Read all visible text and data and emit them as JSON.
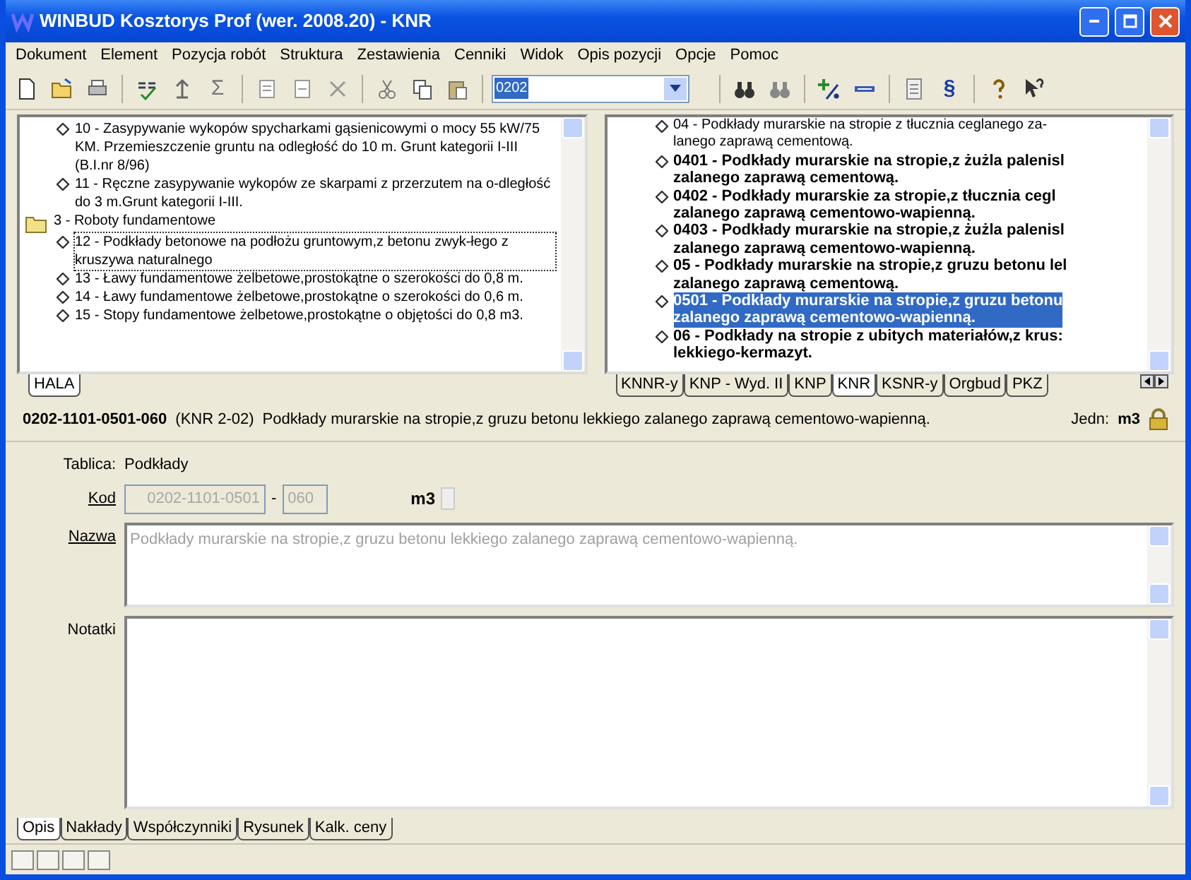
{
  "window": {
    "title": "WINBUD Kosztorys Prof (wer. 2008.20) - KNR"
  },
  "menu": [
    "Dokument",
    "Element",
    "Pozycja robót",
    "Struktura",
    "Zestawienia",
    "Cenniki",
    "Widok",
    "Opis pozycji",
    "Opcje",
    "Pomoc"
  ],
  "toolbar": {
    "sigma_glyph": "Σ",
    "combo_value": "0202",
    "section_glyph": "§"
  },
  "left_tree": {
    "items": [
      {
        "kind": "item",
        "text": "10 - Zasypywanie wykopów spycharkami gąsienicowymi o mocy 55 kW/75 KM. Przemieszczenie gruntu na odległość do 10 m. Grunt kategorii I-III (B.I.nr 8/96)",
        "focused": false
      },
      {
        "kind": "item",
        "text": "11 - Ręczne zasypywanie wykopów ze skarpami z przerzutem na o-dległość do 3 m.Grunt kategorii I-III.",
        "focused": false
      },
      {
        "kind": "folder",
        "text": "3 - Roboty fundamentowe",
        "focused": false,
        "children": [
          {
            "kind": "item",
            "text": "12 - Podkłady betonowe na podłożu gruntowym,z betonu zwyk-łego z kruszywa naturalnego",
            "focused": true
          },
          {
            "kind": "item",
            "text": "13 - Ławy fundamentowe żelbetowe,prostokątne o szerokości do 0,8 m.",
            "focused": false
          },
          {
            "kind": "item",
            "text": "14 - Ławy fundamentowe żelbetowe,prostokątne o szerokości do 0,6 m.",
            "focused": false
          },
          {
            "kind": "item",
            "text": "15 - Stopy fundamentowe żelbetowe,prostokątne o objętości do 0,8 m3.",
            "focused": false
          }
        ]
      }
    ]
  },
  "left_tabs": [
    {
      "label": "HALA",
      "selected": true
    }
  ],
  "right_tree": {
    "items": [
      {
        "lines": [
          "04 - Podkłady murarskie na stropie z tłucznia ceglanego za-",
          "lanego zaprawą cementową."
        ],
        "bold": false,
        "selected": false
      },
      {
        "lines": [
          "0401 - Podkłady murarskie na stropie,z żużla palenisl",
          "zalanego zaprawą cementową."
        ],
        "bold": true,
        "selected": false
      },
      {
        "lines": [
          "0402 - Podkłady murarskie za stropie,z tłucznia cegl",
          "zalanego zaprawą cementowo-wapienną."
        ],
        "bold": true,
        "selected": false
      },
      {
        "lines": [
          "0403 - Podkłady murarskie na stropie,z żużla palenisl",
          "zalanego zaprawą cementowo-wapienną."
        ],
        "bold": true,
        "selected": false
      },
      {
        "lines": [
          "05 - Podkłady murarskie na stropie,z gruzu betonu lel",
          "zalanego zaprawą cementową."
        ],
        "bold": true,
        "selected": false
      },
      {
        "lines": [
          "0501 - Podkłady murarskie na stropie,z gruzu betonu",
          "zalanego zaprawą cementowo-wapienną."
        ],
        "bold": true,
        "selected": true
      },
      {
        "lines": [
          "06 - Podkłady na stropie z ubitych materiałów,z krus:",
          "lekkiego-kermazyt."
        ],
        "bold": true,
        "selected": false
      }
    ]
  },
  "right_tabs": [
    {
      "label": "KNNR-y",
      "selected": false
    },
    {
      "label": "KNP - Wyd. II",
      "selected": false
    },
    {
      "label": "KNP",
      "selected": false
    },
    {
      "label": "KNR",
      "selected": true
    },
    {
      "label": "KSNR-y",
      "selected": false
    },
    {
      "label": "Orgbud",
      "selected": false
    },
    {
      "label": "PKZ",
      "selected": false
    }
  ],
  "position": {
    "code": "0202-1101-0501-060",
    "catalog": "(KNR 2-02)",
    "description": "Podkłady murarskie na stropie,z gruzu betonu lekkiego zalanego zaprawą cementowo-wapienną.",
    "unit_label": "Jedn:",
    "unit": "m3"
  },
  "form": {
    "table_label": "Tablica:",
    "table_value": "Podkłady",
    "code_label": "Kod",
    "code_value": "0202-1101-0501",
    "code_sep": "-",
    "code_suffix": "060",
    "unit": "m3",
    "name_label": "Nazwa",
    "name_value": "Podkłady murarskie na stropie,z gruzu betonu lekkiego zalanego zaprawą cementowo-wapienną.",
    "notes_label": "Notatki"
  },
  "bottom_tabs": [
    {
      "label": "Opis",
      "selected": true
    },
    {
      "label": "Nakłady",
      "selected": false
    },
    {
      "label": "Współczynniki",
      "selected": false
    },
    {
      "label": "Rysunek",
      "selected": false
    },
    {
      "label": "Kalk. ceny",
      "selected": false
    }
  ]
}
